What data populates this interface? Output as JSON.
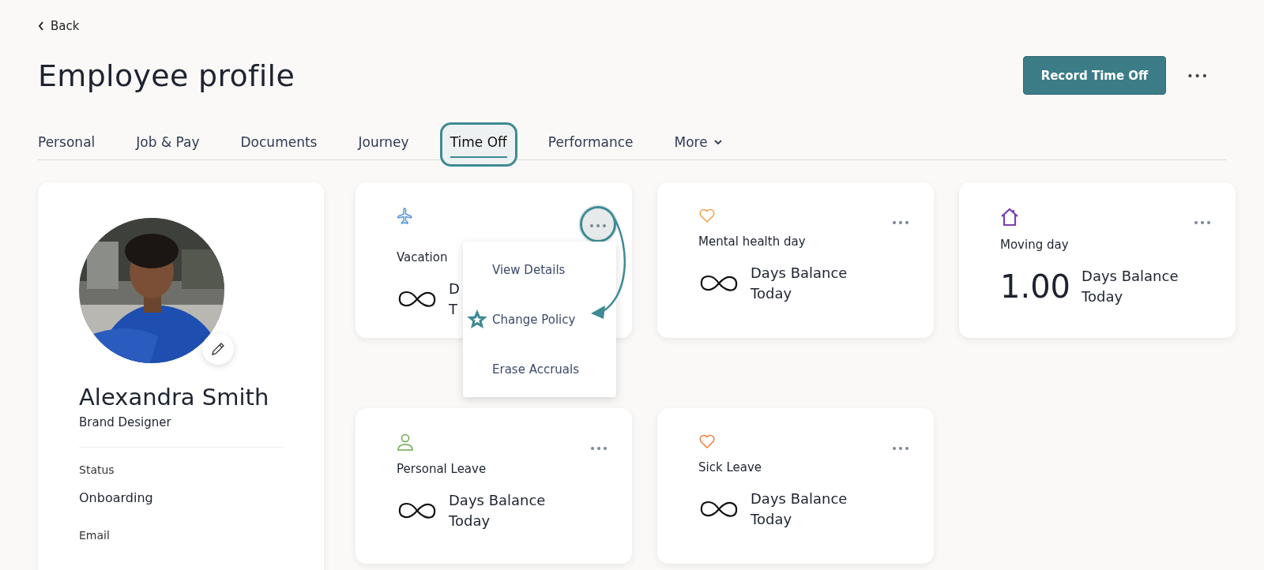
{
  "back_link": {
    "label": "Back"
  },
  "title": "Employee profile",
  "header_actions": {
    "primary_button": "Record Time Off",
    "more_button": "•••"
  },
  "tabs": [
    {
      "label": "Personal",
      "selected": false,
      "highlighted": false
    },
    {
      "label": "Job & Pay",
      "selected": false,
      "highlighted": false
    },
    {
      "label": "Documents",
      "selected": false,
      "highlighted": false
    },
    {
      "label": "Journey",
      "selected": false,
      "highlighted": false
    },
    {
      "label": "Time Off",
      "selected": true,
      "highlighted": true
    },
    {
      "label": "Performance",
      "selected": false,
      "highlighted": false
    },
    {
      "label": "More",
      "selected": false,
      "highlighted": false,
      "kind": "dropdown"
    }
  ],
  "profile": {
    "name": "Alexandra Smith",
    "job_title": "Brand Designer",
    "fields": [
      {
        "label": "Status",
        "value": "Onboarding"
      },
      {
        "label": "Email"
      }
    ]
  },
  "policies": [
    {
      "icon": {
        "kind": "plane",
        "color": "#4a8fd9"
      },
      "name": "Vacation",
      "balance": {
        "kind": "unlimited"
      },
      "balance_lines": [
        "D",
        "T"
      ],
      "menu_open": true,
      "highlighted": true
    },
    {
      "icon": {
        "kind": "heart",
        "color": "#f0a04b"
      },
      "name": "Mental health day",
      "balance": {
        "kind": "unlimited"
      },
      "balance_lines": [
        "Days Balance",
        "Today"
      ],
      "menu_open": false,
      "highlighted": false
    },
    {
      "icon": {
        "kind": "house",
        "color": "#7b3fb0"
      },
      "name": "Moving day",
      "balance": {
        "kind": "number",
        "value": "1.00"
      },
      "balance_lines": [
        "Days Balance",
        "Today"
      ],
      "menu_open": false,
      "highlighted": false
    },
    {
      "icon": {
        "kind": "person",
        "color": "#6aa84f"
      },
      "name": "Personal Leave",
      "balance": {
        "kind": "unlimited"
      },
      "balance_lines": [
        "Days Balance",
        "Today"
      ],
      "menu_open": false,
      "highlighted": false
    },
    {
      "icon": {
        "kind": "heart",
        "color": "#ee7d3a"
      },
      "name": "Sick Leave",
      "balance": {
        "kind": "unlimited"
      },
      "balance_lines": [
        "Days Balance",
        "Today"
      ],
      "menu_open": false,
      "highlighted": false
    }
  ],
  "policy_menu": {
    "items": [
      {
        "label": "View Details",
        "starred": false
      },
      {
        "label": "Change Policy",
        "starred": true
      },
      {
        "label": "Erase Accruals",
        "starred": false
      }
    ]
  }
}
